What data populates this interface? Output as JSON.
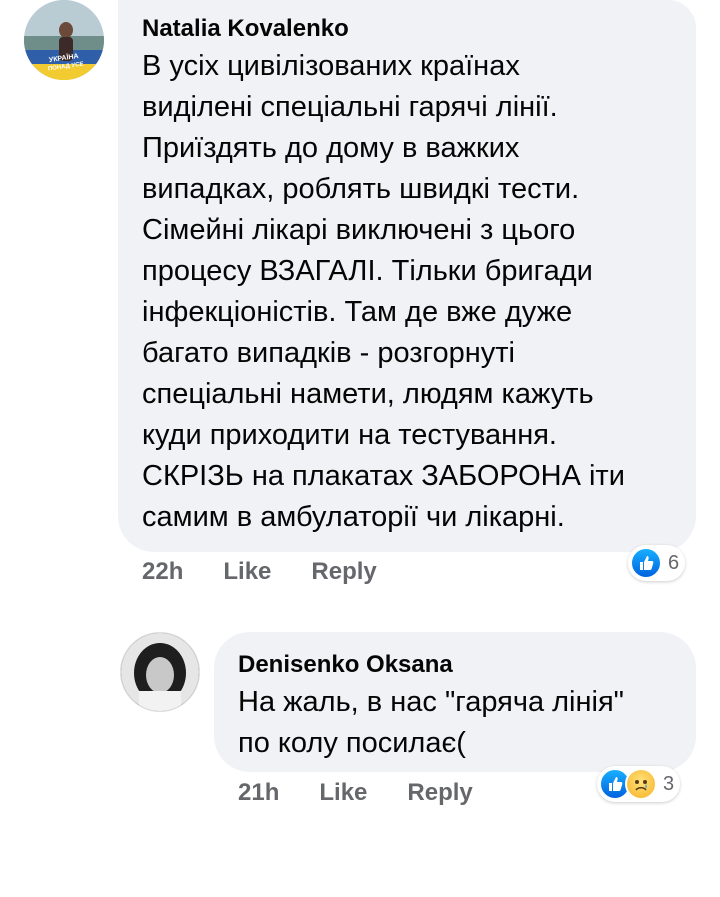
{
  "comments": [
    {
      "author": "Natalia Kovalenko",
      "text": "В усіх цивілізованих країнах\nвиділені спеціальні гарячі лінії.\nПриїздять до дому в важких\nвипадках, роблять швидкі тести.\nСімейні лікарі виключені з цього\nпроцесу ВЗАГАЛІ. Тільки бригади\nінфекціоністів. Там де вже дуже\nбагато випадків - розгорнуті\nспеціальні намети, людям кажуть\nкуди приходити на тестування.\nСКРІЗЬ на плакатах ЗАБОРОНА іти\nсамим в амбулаторії чи лікарні.",
      "time": "22h",
      "like_label": "Like",
      "reply_label": "Reply",
      "reaction_count": "6",
      "reactions": [
        "like-icon"
      ]
    },
    {
      "author": "Denisenko Oksana",
      "text": "На жаль, в нас \"гаряча лінія\"\nпо колу посилає(",
      "time": "21h",
      "like_label": "Like",
      "reply_label": "Reply",
      "reaction_count": "3",
      "reactions": [
        "like-icon",
        "sad-icon"
      ]
    }
  ],
  "avatar_badge_text": "УКРАЇНА ПОНАД УСЕ",
  "colors": {
    "bubble": "#f0f2f5",
    "meta_text": "#65676b",
    "like_blue": "#1877f2",
    "sad_yellow": "#f7b125"
  }
}
